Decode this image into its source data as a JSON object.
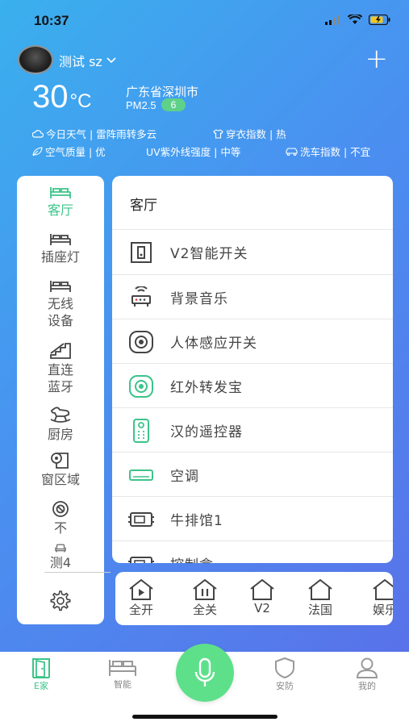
{
  "status_bar": {
    "time": "10:37"
  },
  "header": {
    "home_name": "测试 sz",
    "temperature": "30",
    "temp_unit": "°C",
    "city": "广东省深圳市",
    "pm_label": "PM2.5",
    "pm_value": "6"
  },
  "weather_info": {
    "today_weather": "今日天气 | 雷阵雨转多云",
    "dressing_index": "穿衣指数 | 热",
    "air_quality": "空气质量 | 优",
    "uv_index": "UV紫外线强度 | 中等",
    "car_wash_index": "洗车指数 | 不宜"
  },
  "sidebar": {
    "items": [
      {
        "label": "客厅",
        "icon": "bed-icon",
        "active": true
      },
      {
        "label": "插座灯",
        "icon": "bed-icon"
      },
      {
        "label": "无线设备",
        "icon": "bed-icon"
      },
      {
        "label": "直连蓝牙",
        "icon": "stairs-icon"
      },
      {
        "label": "厨房",
        "icon": "rocking-horse-icon"
      },
      {
        "label": "窗区域",
        "icon": "toilet-paper-icon"
      },
      {
        "label": "不",
        "icon": "safe-icon"
      },
      {
        "label": "测4",
        "icon": "sofa-icon"
      }
    ],
    "settings_icon": "gear-icon"
  },
  "room_panel": {
    "title": "客厅",
    "devices": [
      {
        "label": "V2智能开关",
        "icon": "switch-icon"
      },
      {
        "label": "背景音乐",
        "icon": "router-icon"
      },
      {
        "label": "人体感应开关",
        "icon": "sensor-icon"
      },
      {
        "label": "红外转发宝",
        "icon": "ir-blaster-icon"
      },
      {
        "label": "汉的遥控器",
        "icon": "remote-icon"
      },
      {
        "label": "空调",
        "icon": "air-conditioner-icon"
      },
      {
        "label": "牛排馆1",
        "icon": "projector-icon"
      },
      {
        "label": "控制盒",
        "icon": "box-icon"
      }
    ]
  },
  "scenes": [
    {
      "label": "全开",
      "icon": "home-play-icon"
    },
    {
      "label": "全关",
      "icon": "home-pause-icon"
    },
    {
      "label": "V2",
      "icon": "home-icon"
    },
    {
      "label": "法国",
      "icon": "home-icon"
    },
    {
      "label": "娱乐",
      "icon": "home-icon"
    }
  ],
  "tabbar": {
    "tabs": [
      {
        "label": "E家",
        "icon": "door-icon",
        "active": true
      },
      {
        "label": "智能",
        "icon": "bed-icon"
      },
      {
        "label": "安防",
        "icon": "shield-icon"
      },
      {
        "label": "我的",
        "icon": "user-icon"
      }
    ],
    "mic_icon": "microphone-icon"
  },
  "colors": {
    "accent": "#3cc489",
    "pm_badge": "#5fd08a",
    "mic": "#5ee08a"
  }
}
